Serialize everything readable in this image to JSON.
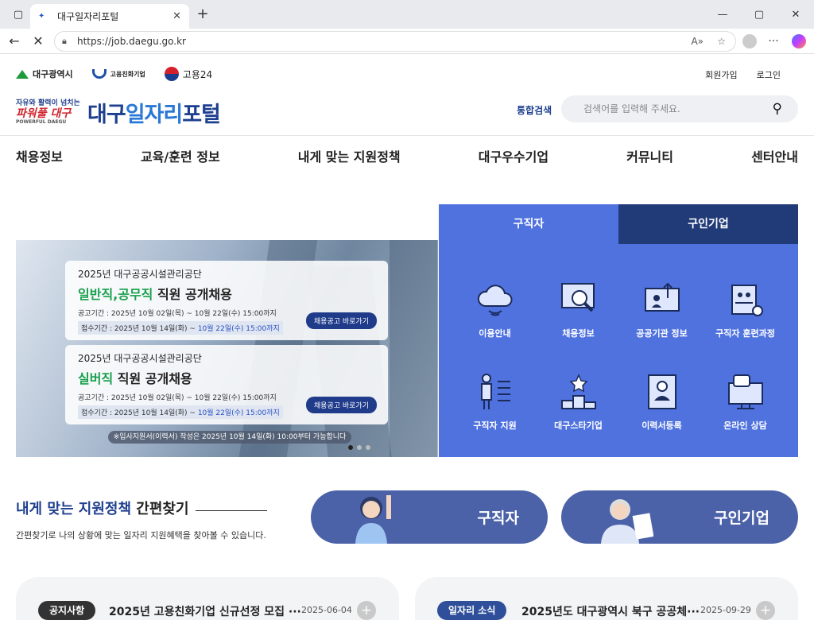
{
  "browser": {
    "tab_title": "대구일자리포털",
    "url": "https://job.daegu.go.kr"
  },
  "header": {
    "logos": [
      "대구광역시",
      "고용친화기업",
      "고용24"
    ],
    "links": {
      "signup": "회원가입",
      "login": "로그인"
    },
    "brand": {
      "slogan1": "자유와 활력이 넘치는",
      "slogan2": "파워풀 대구",
      "slogan3": "POWERFUL DAEGU",
      "title_a": "대구",
      "title_b": "일자리",
      "title_c": "포털"
    },
    "search": {
      "label": "통합검색",
      "placeholder": "검색어를 입력해 주세요."
    }
  },
  "nav": [
    "채용정보",
    "교육/훈련 정보",
    "내게 맞는 지원정책",
    "대구우수기업",
    "커뮤니티",
    "센터안내"
  ],
  "banner": {
    "cards": [
      {
        "org": "2025년 대구공공시설관리공단",
        "title_hl": "일반직,공무직",
        "title_rest": " 직원 공개채용",
        "period1": "공고기간 : 2025년 10월 02일(목) ~ 10월 22일(수) 15:00까지",
        "period2_a": "접수기간 : 2025년 10월 14일(화) ~ ",
        "period2_b": "10월 22일(수) 15:00까지",
        "button": "채용공고 바로가기"
      },
      {
        "org": "2025년 대구공공시설관리공단",
        "title_hl": "실버직",
        "title_rest": " 직원 공개채용",
        "period1": "공고기간 : 2025년 10월 02일(목) ~ 10월 22일(수) 15:00까지",
        "period2_a": "접수기간 : 2025년 10월 14일(화) ~ ",
        "period2_b": "10월 22일(수) 15:00까지",
        "button": "채용공고 바로가기"
      }
    ],
    "notice": "※입사지원서(이력서) 작성은 2025년 10월 14일(화) 10:00부터 가능합니다"
  },
  "services": {
    "tabs": [
      "구직자",
      "구인기업"
    ],
    "items": [
      "이용안내",
      "채용정보",
      "공공기관 정보",
      "구직자 훈련과정",
      "구직자 지원",
      "대구스타기업",
      "이력서등록",
      "온라인 상담"
    ]
  },
  "quickfind": {
    "title_a": "내게 맞는 지원정책",
    "title_b": " 간편찾기",
    "desc": "간편찾기로 나의 상황에 맞는 일자리 지원혜택을 찾아볼 수 있습니다.",
    "buttons": [
      "구직자",
      "구인기업"
    ]
  },
  "notices": [
    {
      "badge": "공지사항",
      "text": "2025년 고용친화기업 신규선정 모집 ···",
      "date": "2025-06-04",
      "badge_color": "#333333"
    },
    {
      "badge": "일자리 소식",
      "text": "2025년도 대구광역시 북구 공공체···",
      "date": "2025-09-29",
      "badge_color": "#2f4f9a"
    }
  ]
}
